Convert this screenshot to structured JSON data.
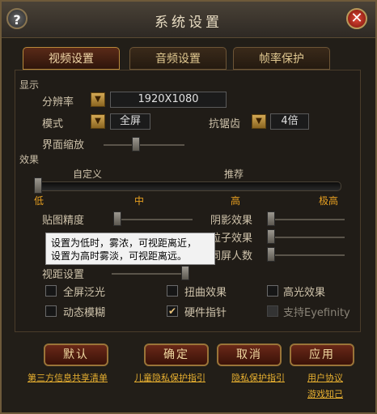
{
  "window": {
    "title": "系统设置",
    "help_label": "?",
    "close_label": "✕"
  },
  "tabs": [
    {
      "label": "视频设置",
      "active": true
    },
    {
      "label": "音频设置",
      "active": false
    },
    {
      "label": "帧率保护",
      "active": false
    }
  ],
  "display_section": {
    "title": "显示",
    "resolution": {
      "label": "分辨率",
      "value": "1920X1080"
    },
    "mode": {
      "label": "模式",
      "value": "全屏"
    },
    "antialias": {
      "label": "抗锯齿",
      "value": "4倍"
    },
    "ui_scale": {
      "label": "界面缩放",
      "level": 0.25
    }
  },
  "effects_section": {
    "title": "效果",
    "preset_top_labels": {
      "custom": "自定义",
      "recommended": "推荐"
    },
    "preset_ticks": [
      "低",
      "中",
      "高",
      "极高"
    ],
    "preset_level": 0,
    "texture_quality": {
      "label": "贴图精度",
      "level": 0.0
    },
    "shadow_effect": {
      "label": "阴影效果",
      "level": 0.0
    },
    "particle_effect": {
      "label": "粒子效果",
      "level": 0.0
    },
    "same_screen_count": {
      "label": "同屏人数",
      "level": 0.0
    },
    "view_distance": {
      "label": "视距设置",
      "level": 1.0
    },
    "tooltip": [
      "设置为低时，雾浓，可视距离近，",
      "设置为高时雾淡，可视距离远。"
    ]
  },
  "checkboxes": [
    {
      "label": "全屏泛光",
      "checked": false,
      "enabled": true
    },
    {
      "label": "扭曲效果",
      "checked": false,
      "enabled": true
    },
    {
      "label": "高光效果",
      "checked": false,
      "enabled": true
    },
    {
      "label": "动态模糊",
      "checked": false,
      "enabled": true
    },
    {
      "label": "硬件指针",
      "checked": true,
      "enabled": true
    },
    {
      "label": "支持Eyefinity",
      "checked": false,
      "enabled": false
    }
  ],
  "buttons": {
    "default": "默认",
    "confirm": "确定",
    "cancel": "取消",
    "apply": "应用"
  },
  "links": {
    "third_party": "第三方信息共享清单",
    "child_privacy": "儿童隐私保护指引",
    "privacy": "隐私保护指引",
    "user_agreement": "用户协议",
    "game_notice": "游戏知己"
  }
}
